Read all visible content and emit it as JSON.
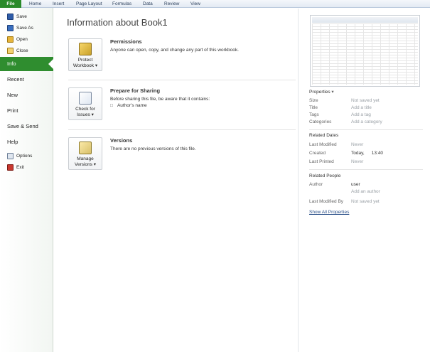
{
  "ribbon": {
    "tabs": [
      "File",
      "Home",
      "Insert",
      "Page Layout",
      "Formulas",
      "Data",
      "Review",
      "View"
    ]
  },
  "nav": {
    "commands": [
      "Save",
      "Save As",
      "Open",
      "Close"
    ],
    "sections": [
      "Info",
      "Recent",
      "New",
      "Print",
      "Save & Send",
      "Help"
    ],
    "bottom_commands": [
      "Options",
      "Exit"
    ]
  },
  "main": {
    "title": "Information about Book1",
    "permissions": {
      "button_line1": "Protect",
      "button_line2": "Workbook ▾",
      "heading": "Permissions",
      "description": "Anyone can open, copy, and change any part of this workbook."
    },
    "sharing": {
      "button_line1": "Check for",
      "button_line2": "Issues ▾",
      "heading": "Prepare for Sharing",
      "description": "Before sharing this file, be aware that it contains:",
      "item": "Author's name"
    },
    "versions": {
      "button_line1": "Manage",
      "button_line2": "Versions ▾",
      "heading": "Versions",
      "item": "There are no previous versions of this file."
    }
  },
  "properties": {
    "heading": "Properties",
    "rows": [
      {
        "k": "Size",
        "v": "Not saved yet"
      },
      {
        "k": "Title",
        "v": "Add a title"
      },
      {
        "k": "Tags",
        "v": "Add a tag"
      },
      {
        "k": "Categories",
        "v": "Add a category"
      }
    ],
    "dates_heading": "Related Dates",
    "dates": [
      {
        "k": "Last Modified",
        "v": "Never"
      },
      {
        "k": "Created",
        "v": "Today,   13:40"
      },
      {
        "k": "Last Printed",
        "v": "Never"
      }
    ],
    "people_heading": "Related People",
    "author_label": "Author",
    "author_value": "user",
    "add_author": "Add an author",
    "last_modified_by_label": "Last Modified By",
    "last_modified_by_value": "Not saved yet",
    "show_all": "Show All Properties"
  },
  "colors": {
    "file_tab": "#2a8a2a",
    "active_section": "#2f8d2f",
    "link": "#2a4f88"
  }
}
